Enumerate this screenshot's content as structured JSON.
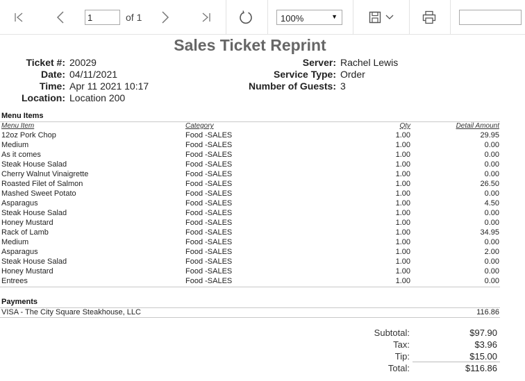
{
  "toolbar": {
    "page_value": "1",
    "page_of": "of 1",
    "zoom_value": "100%",
    "search_value": ""
  },
  "report": {
    "title": "Sales Ticket Reprint",
    "header_left": [
      {
        "label": "Ticket #:",
        "value": "20029"
      },
      {
        "label": "Date:",
        "value": "04/11/2021"
      },
      {
        "label": "Time:",
        "value": "Apr 11 2021 10:17"
      },
      {
        "label": "Location:",
        "value": "Location 200"
      }
    ],
    "header_right": [
      {
        "label": "Server:",
        "value": "Rachel Lewis"
      },
      {
        "label": "Service Type:",
        "value": "Order"
      },
      {
        "label": "Number of Guests:",
        "value": "3"
      }
    ],
    "menu_items_title": "Menu Items",
    "columns": {
      "item": "Menu Item",
      "category": "Category",
      "qty": "Qty",
      "amount": "Detail Amount"
    },
    "items": [
      {
        "item": "12oz Pork Chop",
        "category": "Food -SALES",
        "qty": "1.00",
        "amount": "29.95"
      },
      {
        "item": "Medium",
        "category": "Food -SALES",
        "qty": "1.00",
        "amount": "0.00"
      },
      {
        "item": "As it comes",
        "category": "Food -SALES",
        "qty": "1.00",
        "amount": "0.00"
      },
      {
        "item": "Steak House Salad",
        "category": "Food -SALES",
        "qty": "1.00",
        "amount": "0.00"
      },
      {
        "item": "Cherry Walnut Vinaigrette",
        "category": "Food -SALES",
        "qty": "1.00",
        "amount": "0.00"
      },
      {
        "item": "Roasted Filet of Salmon",
        "category": "Food -SALES",
        "qty": "1.00",
        "amount": "26.50"
      },
      {
        "item": "Mashed Sweet Potato",
        "category": "Food -SALES",
        "qty": "1.00",
        "amount": "0.00"
      },
      {
        "item": "Asparagus",
        "category": "Food -SALES",
        "qty": "1.00",
        "amount": "4.50"
      },
      {
        "item": "Steak House Salad",
        "category": "Food -SALES",
        "qty": "1.00",
        "amount": "0.00"
      },
      {
        "item": "Honey Mustard",
        "category": "Food -SALES",
        "qty": "1.00",
        "amount": "0.00"
      },
      {
        "item": "Rack of Lamb",
        "category": "Food -SALES",
        "qty": "1.00",
        "amount": "34.95"
      },
      {
        "item": "Medium",
        "category": "Food -SALES",
        "qty": "1.00",
        "amount": "0.00"
      },
      {
        "item": "Asparagus",
        "category": "Food -SALES",
        "qty": "1.00",
        "amount": "2.00"
      },
      {
        "item": "Steak House Salad",
        "category": "Food -SALES",
        "qty": "1.00",
        "amount": "0.00"
      },
      {
        "item": "Honey Mustard",
        "category": "Food -SALES",
        "qty": "1.00",
        "amount": "0.00"
      },
      {
        "item": "Entrees",
        "category": "Food -SALES",
        "qty": "1.00",
        "amount": "0.00"
      }
    ],
    "payments_title": "Payments",
    "payment": {
      "name": "VISA  - The City Square Steakhouse, LLC",
      "amount": "116.86"
    },
    "totals": [
      {
        "label": "Subtotal:",
        "value": "$97.90"
      },
      {
        "label": "Tax:",
        "value": "$3.96"
      },
      {
        "label": "Tip:",
        "value": "$15.00"
      },
      {
        "label": "Total:",
        "value": "$116.86"
      }
    ]
  }
}
